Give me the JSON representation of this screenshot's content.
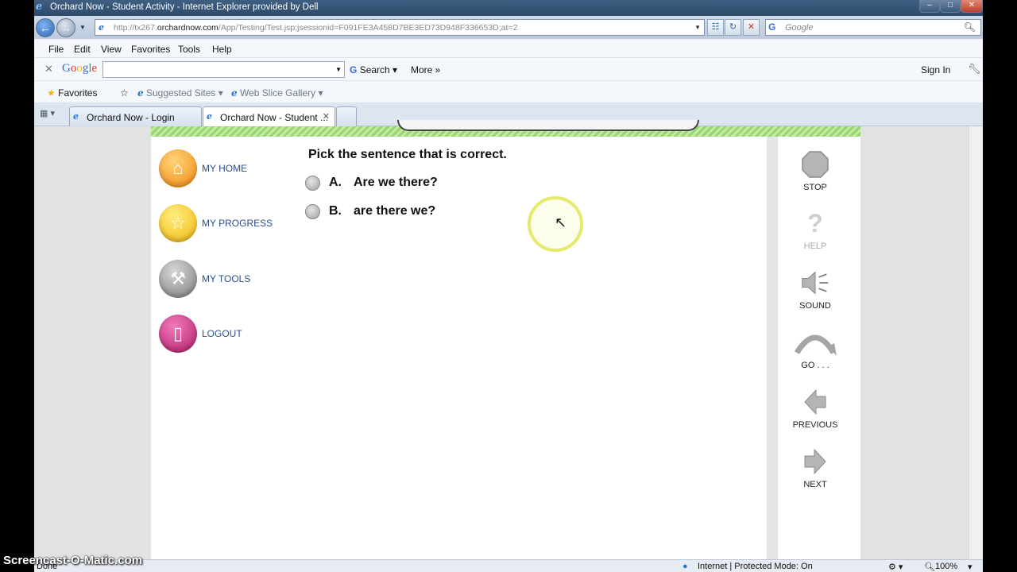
{
  "window": {
    "title": "Orchard Now - Student Activity - Internet Explorer provided by Dell",
    "min": "–",
    "max": "□",
    "close": "✕"
  },
  "address": {
    "url_prefix": "http://tx267.",
    "url_domain": "orchardnow.com",
    "url_path": "/App/Testing/Test.jsp;jsessionid=F091FE3A458D7BE3ED73D948F336653D;at=2",
    "search_placeholder": "Google"
  },
  "menu": [
    "File",
    "Edit",
    "View",
    "Favorites",
    "Tools",
    "Help"
  ],
  "google_toolbar": {
    "logo": "Google",
    "search_label": "Search",
    "more_label": "More »",
    "sign_in": "Sign In"
  },
  "favorites_bar": {
    "favorites": "Favorites",
    "suggested": "Suggested Sites",
    "web_slice": "Web Slice Gallery"
  },
  "tabs": [
    {
      "label": "Orchard Now - Login"
    },
    {
      "label": "Orchard Now - Student ...",
      "active": true
    }
  ],
  "nav": {
    "home": "MY HOME",
    "progress": "MY PROGRESS",
    "tools": "MY TOOLS",
    "logout": "LOGOUT"
  },
  "question": {
    "prompt": "Pick the sentence that is correct.",
    "options": [
      {
        "letter": "A.",
        "text": "Are we there?"
      },
      {
        "letter": "B.",
        "text": "are there we?"
      }
    ]
  },
  "tools": {
    "stop": "STOP",
    "help": "HELP",
    "sound": "SOUND",
    "go": "GO . . .",
    "previous": "PREVIOUS",
    "next": "NEXT"
  },
  "status": {
    "left": "Done",
    "zone": "Internet | Protected Mode: On",
    "zoom": "100%"
  },
  "watermark": "Screencast-O-Matic.com",
  "colors": {
    "home": "#f6a21a",
    "progress": "#f5cd1a",
    "tools": "#8f8f8f",
    "logout": "#c2337f",
    "banner": "#9ad66f"
  }
}
